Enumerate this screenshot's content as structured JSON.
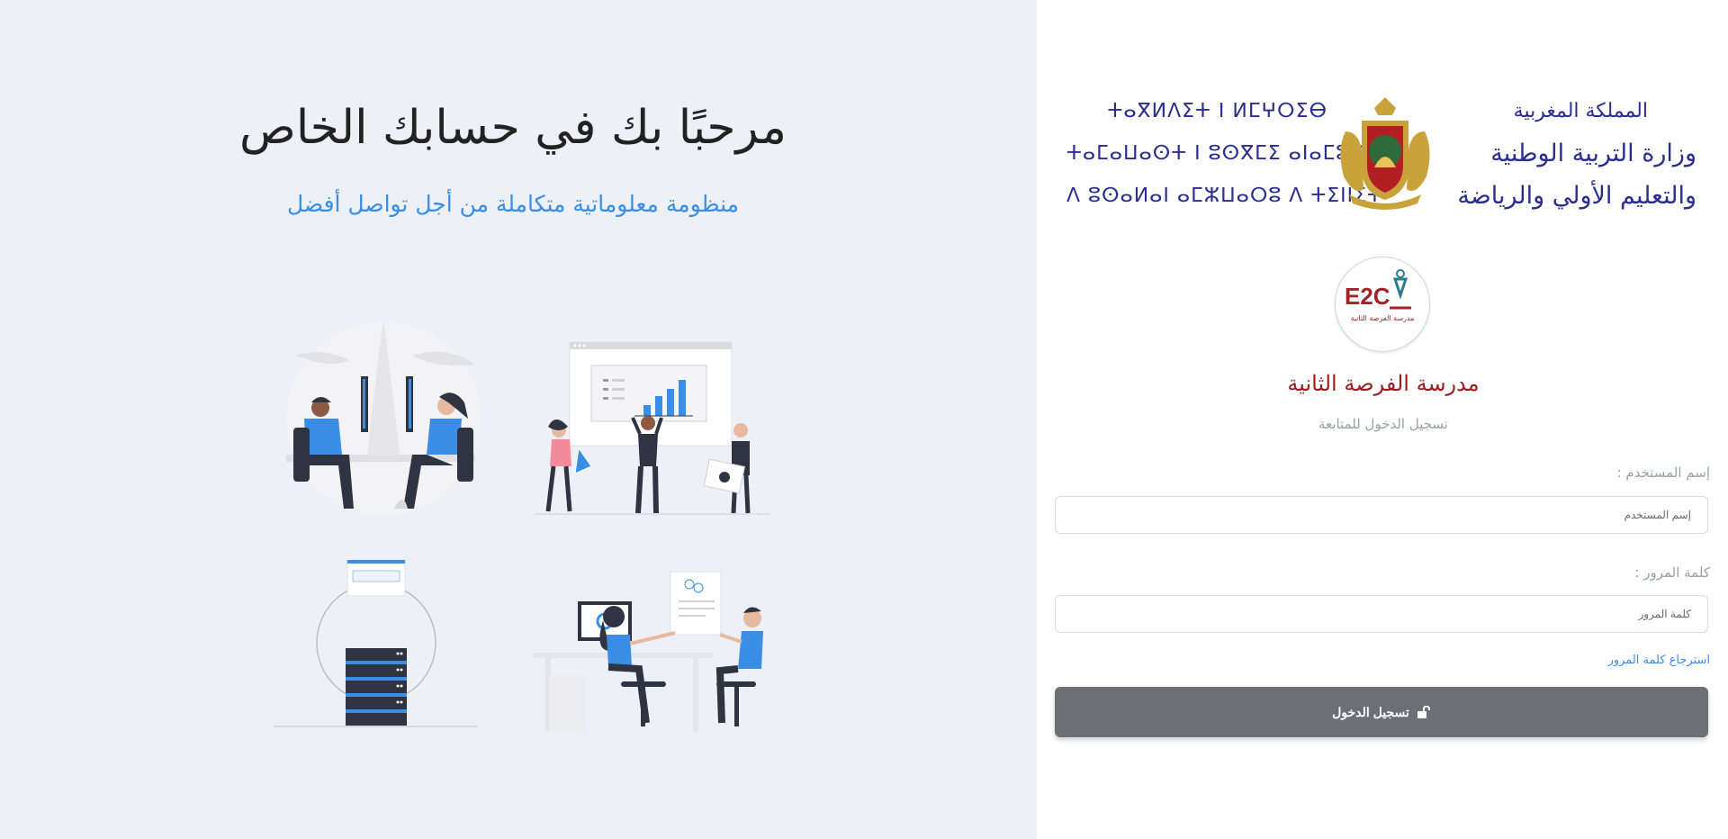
{
  "left": {
    "welcome_title": "مرحبًا بك في حسابك الخاص",
    "subtitle": "منظومة معلوماتية متكاملة من أجل تواصل أفضل"
  },
  "ministry": {
    "arabic_lines": [
      "المملكة المغربية",
      "وزارة التربية الوطنية",
      "والتعليم الأولي والرياضة"
    ],
    "tifinagh_lines": [
      "ⵜⴰⴳⵍⴷⵉⵜ ⵏ ⵍⵎⵖⵔⵉⴱ",
      "ⵜⴰⵎⴰⵡⴰⵙⵜ ⵏ ⵓⵙⴳⵎⵉ ⴰⵏⴰⵎⵓⵔ",
      "ⴷ ⵓⵙⴰⵍⴰⵏ ⴰⵎⵣⵡⴰⵔⵓ ⴷ ⵜⵉⵏⵏⵉⵜ"
    ]
  },
  "school": {
    "logo_text": "E2C",
    "logo_caption": "مدرسة الفرصة الثانية",
    "name": "مدرسة الفرصة الثانية",
    "subtitle": "تسجيل الدخول للمتابعة"
  },
  "form": {
    "username_label": "إسم المستخدم :",
    "username_placeholder": "إسم المستخدم",
    "password_label": "كلمة المرور :",
    "password_placeholder": "كلمة المرور",
    "recover_link": "استرجاع كلمة المرور",
    "login_button": "تسجيل الدخول",
    "login_icon": "unlock-icon"
  },
  "colors": {
    "accent": "#3a8ee6",
    "school_red": "#9c1c1c",
    "ministry_blue": "#2b2e8f",
    "button_gray": "#6d6f77",
    "left_bg": "#eef0f8"
  }
}
